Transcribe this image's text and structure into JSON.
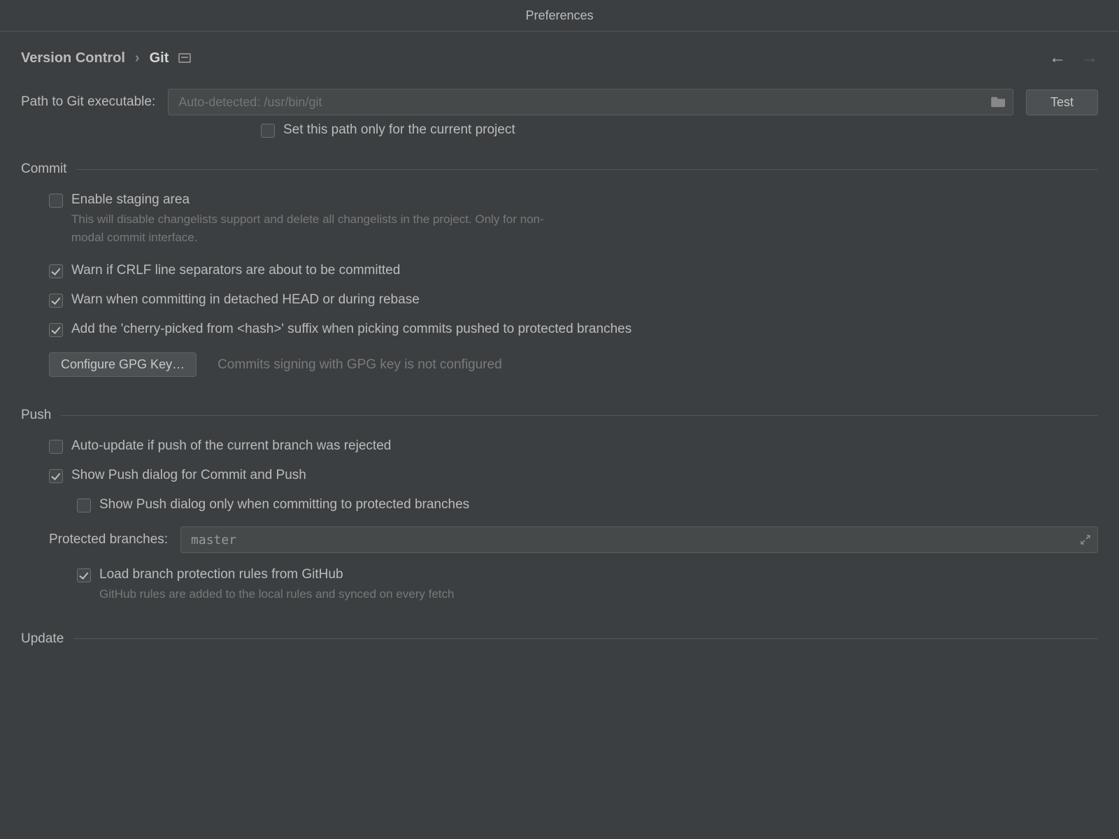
{
  "window": {
    "title": "Preferences"
  },
  "breadcrumb": {
    "parent": "Version Control",
    "current": "Git"
  },
  "pathRow": {
    "label": "Path to Git executable:",
    "placeholder": "Auto-detected: /usr/bin/git",
    "testButton": "Test",
    "setOnlyProject": "Set this path only for the current project"
  },
  "sections": {
    "commit": {
      "title": "Commit",
      "enableStaging": {
        "label": "Enable staging area",
        "hint": "This will disable changelists support and delete all changelists in the project. Only for non-modal commit interface."
      },
      "warnCrlf": "Warn if CRLF line separators are about to be committed",
      "warnDetached": "Warn when committing in detached HEAD or during rebase",
      "cherryPickSuffix": "Add the 'cherry-picked from <hash>' suffix when picking commits pushed to protected branches",
      "gpgButton": "Configure GPG Key…",
      "gpgHint": "Commits signing with GPG key is not configured"
    },
    "push": {
      "title": "Push",
      "autoUpdate": "Auto-update if push of the current branch was rejected",
      "showPushDialog": "Show Push dialog for Commit and Push",
      "showPushOnlyProtected": "Show Push dialog only when committing to protected branches",
      "protectedLabel": "Protected branches:",
      "protectedValue": "master",
      "loadFromGithub": {
        "label": "Load branch protection rules from GitHub",
        "hint": "GitHub rules are added to the local rules and synced on every fetch"
      }
    },
    "update": {
      "title": "Update"
    }
  }
}
